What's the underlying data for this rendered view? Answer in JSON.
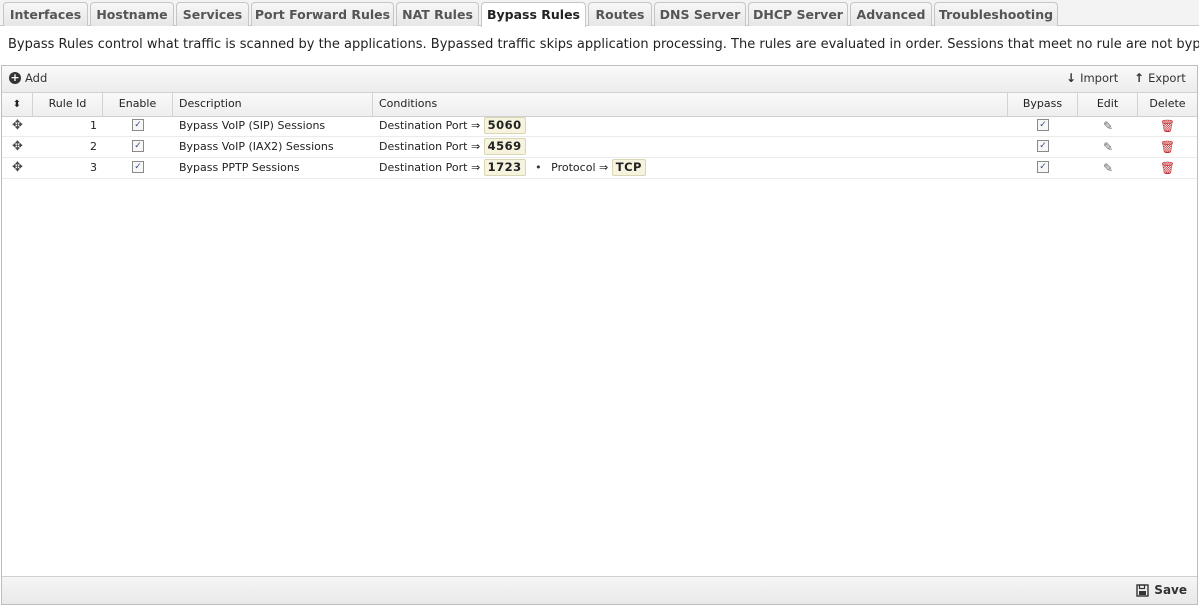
{
  "tabs": [
    {
      "label": "Interfaces",
      "active": false
    },
    {
      "label": "Hostname",
      "active": false
    },
    {
      "label": "Services",
      "active": false
    },
    {
      "label": "Port Forward Rules",
      "active": false
    },
    {
      "label": "NAT Rules",
      "active": false
    },
    {
      "label": "Bypass Rules",
      "active": true
    },
    {
      "label": "Routes",
      "active": false
    },
    {
      "label": "DNS Server",
      "active": false
    },
    {
      "label": "DHCP Server",
      "active": false
    },
    {
      "label": "Advanced",
      "active": false
    },
    {
      "label": "Troubleshooting",
      "active": false
    }
  ],
  "description": "Bypass Rules control what traffic is scanned by the applications. Bypassed traffic skips application processing. The rules are evaluated in order. Sessions that meet no rule are not bypassed.",
  "toolbar": {
    "add_label": "Add",
    "import_label": "Import",
    "export_label": "Export"
  },
  "grid": {
    "columns": {
      "rule_id": "Rule Id",
      "enable": "Enable",
      "description": "Description",
      "conditions": "Conditions",
      "bypass": "Bypass",
      "edit": "Edit",
      "delete": "Delete"
    },
    "rows": [
      {
        "rule_id": "1",
        "enabled": true,
        "description": "Bypass VoIP (SIP) Sessions",
        "conditions": [
          {
            "name": "Destination Port",
            "value": "5060"
          }
        ],
        "bypass": true
      },
      {
        "rule_id": "2",
        "enabled": true,
        "description": "Bypass VoIP (IAX2) Sessions",
        "conditions": [
          {
            "name": "Destination Port",
            "value": "4569"
          }
        ],
        "bypass": true
      },
      {
        "rule_id": "3",
        "enabled": true,
        "description": "Bypass PPTP Sessions",
        "conditions": [
          {
            "name": "Destination Port",
            "value": "1723"
          },
          {
            "name": "Protocol",
            "value": "TCP"
          }
        ],
        "bypass": true
      }
    ]
  },
  "condition_operator": "⇒",
  "condition_separator": "•",
  "footer": {
    "save_label": "Save"
  },
  "icons": {
    "sort": "sort-icon",
    "drag": "move-icon",
    "edit": "pencil-icon",
    "delete": "trash-icon",
    "add": "plus-circle-icon",
    "import": "arrow-down-icon",
    "export": "arrow-up-icon",
    "save": "floppy-icon"
  },
  "colors": {
    "delete_icon": "#c0282d",
    "value_badge_bg": "#f6f4de"
  }
}
